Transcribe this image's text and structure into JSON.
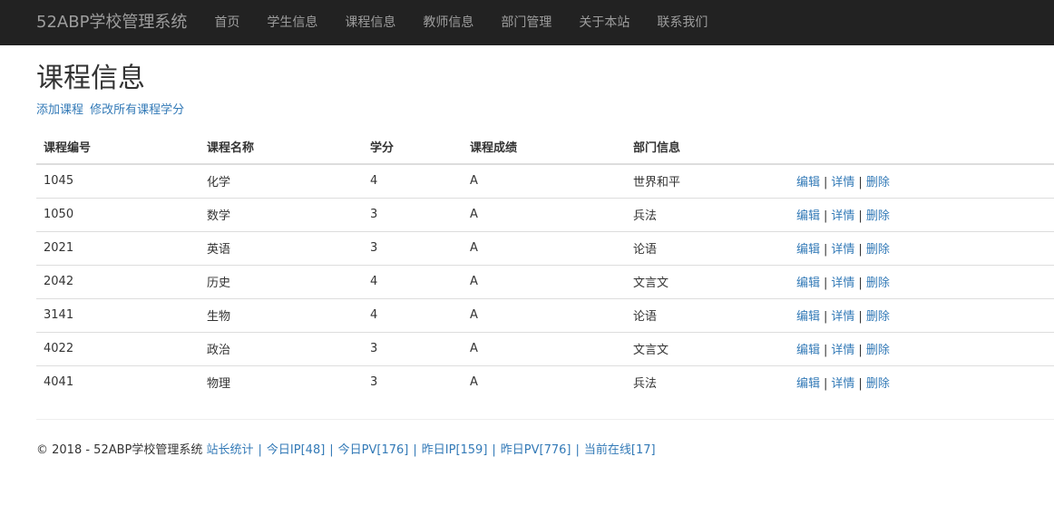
{
  "navbar": {
    "brand": "52ABP学校管理系统",
    "items": [
      {
        "label": "首页"
      },
      {
        "label": "学生信息"
      },
      {
        "label": "课程信息"
      },
      {
        "label": "教师信息"
      },
      {
        "label": "部门管理"
      },
      {
        "label": "关于本站"
      },
      {
        "label": "联系我们"
      }
    ]
  },
  "page": {
    "title": "课程信息",
    "add_course": "添加课程",
    "edit_all_credits": "修改所有课程学分"
  },
  "table": {
    "headers": [
      "课程编号",
      "课程名称",
      "学分",
      "课程成绩",
      "部门信息"
    ],
    "rows": [
      {
        "id": "1045",
        "name": "化学",
        "credits": "4",
        "grade": "A",
        "dept": "世界和平"
      },
      {
        "id": "1050",
        "name": "数学",
        "credits": "3",
        "grade": "A",
        "dept": "兵法"
      },
      {
        "id": "2021",
        "name": "英语",
        "credits": "3",
        "grade": "A",
        "dept": "论语"
      },
      {
        "id": "2042",
        "name": "历史",
        "credits": "4",
        "grade": "A",
        "dept": "文言文"
      },
      {
        "id": "3141",
        "name": "生物",
        "credits": "4",
        "grade": "A",
        "dept": "论语"
      },
      {
        "id": "4022",
        "name": "政治",
        "credits": "3",
        "grade": "A",
        "dept": "文言文"
      },
      {
        "id": "4041",
        "name": "物理",
        "credits": "3",
        "grade": "A",
        "dept": "兵法"
      }
    ],
    "row_actions": {
      "edit": "编辑",
      "details": "详情",
      "delete": "删除",
      "separator": "|"
    }
  },
  "footer": {
    "copyright": "© 2018 - 52ABP学校管理系统",
    "separator": "|",
    "links": [
      {
        "label": "站长统计"
      },
      {
        "label": "今日IP[48]"
      },
      {
        "label": "今日PV[176]"
      },
      {
        "label": "昨日IP[159]"
      },
      {
        "label": "昨日PV[776]"
      },
      {
        "label": "当前在线[17]"
      }
    ]
  },
  "colors": {
    "navbar_bg": "#222222",
    "navbar_text": "#9d9d9d",
    "link": "#337ab7",
    "text": "#333333"
  }
}
